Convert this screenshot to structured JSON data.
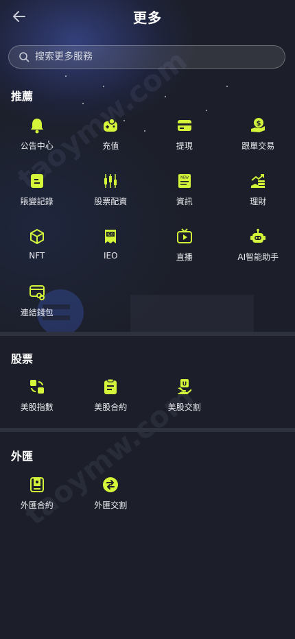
{
  "header": {
    "title": "更多"
  },
  "search": {
    "placeholder": "搜索更多服務"
  },
  "watermark": "taoymw.com",
  "accent": "#d4f53a",
  "sections": [
    {
      "title": "推薦",
      "items": [
        {
          "label": "公告中心",
          "icon": "bell-icon"
        },
        {
          "label": "充值",
          "icon": "deposit-wallet-icon"
        },
        {
          "label": "提現",
          "icon": "withdraw-card-icon"
        },
        {
          "label": "跟單交易",
          "icon": "copy-trade-icon"
        },
        {
          "label": "賬變記錄",
          "icon": "record-icon"
        },
        {
          "label": "股票配資",
          "icon": "candlestick-icon"
        },
        {
          "label": "資訊",
          "icon": "news-icon"
        },
        {
          "label": "理財",
          "icon": "finance-icon"
        },
        {
          "label": "NFT",
          "icon": "nft-cube-icon"
        },
        {
          "label": "IEO",
          "icon": "ieo-icon"
        },
        {
          "label": "直播",
          "icon": "live-tv-icon"
        },
        {
          "label": "AI智能助手",
          "icon": "robot-icon"
        },
        {
          "label": "連結錢包",
          "icon": "link-wallet-icon"
        }
      ]
    },
    {
      "title": "股票",
      "items": [
        {
          "label": "美股指數",
          "icon": "index-icon"
        },
        {
          "label": "美股合約",
          "icon": "contract-clipboard-icon"
        },
        {
          "label": "美股交割",
          "icon": "delivery-icon"
        }
      ]
    },
    {
      "title": "外匯",
      "items": [
        {
          "label": "外匯合約",
          "icon": "forex-contract-icon"
        },
        {
          "label": "外匯交割",
          "icon": "exchange-icon"
        }
      ]
    }
  ]
}
